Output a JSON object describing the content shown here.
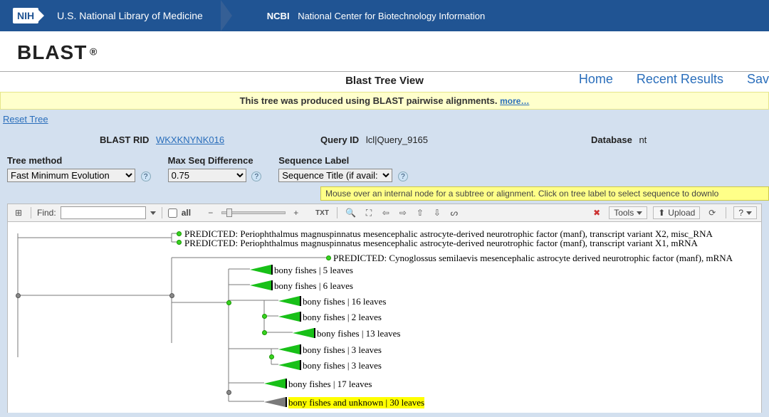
{
  "header": {
    "nih_badge": "NIH",
    "nlm": "U.S. National Library of Medicine",
    "ncbi_short": "NCBI",
    "ncbi_long": "National Center for Biotechnology Information"
  },
  "page": {
    "blast_title": "BLAST",
    "blast_reg": "®",
    "heading": "Blast Tree View",
    "right_links": {
      "home": "Home",
      "recent": "Recent Results",
      "save": "Sav"
    },
    "yellow_bar_text": "This tree was produced using BLAST pairwise alignments.",
    "yellow_bar_more": "more…",
    "reset_link": "Reset Tree"
  },
  "meta": {
    "rid_label": "BLAST RID",
    "rid_value": "WKXKNYNK016",
    "query_label": "Query ID",
    "query_value": "lcl|Query_9165",
    "db_label": "Database",
    "db_value": "nt"
  },
  "controls": {
    "tree_method_label": "Tree method",
    "tree_method_value": "Fast Minimum Evolution",
    "max_seq_label": "Max Seq Difference",
    "max_seq_value": "0.75",
    "seq_label_label": "Sequence Label",
    "seq_label_value": "Sequence Title (if avail:",
    "hint": "Mouse over an internal node for a subtree or alignment. Click on tree label to select sequence to downlo"
  },
  "toolbar": {
    "find_label": "Find:",
    "all": "all",
    "minus": "−",
    "plus": "+",
    "txt": "TXT",
    "tools": "Tools",
    "upload": "Upload",
    "question": "?"
  },
  "tree": {
    "top1": "PREDICTED: Periophthalmus magnuspinnatus mesencephalic astrocyte-derived neurotrophic factor (manf), transcript variant X2, misc_RNA",
    "top2": "PREDICTED: Periophthalmus magnuspinnatus mesencephalic astrocyte-derived neurotrophic factor (manf), transcript variant X1, mRNA",
    "top3": "PREDICTED: Cynoglossus semilaevis mesencephalic astrocyte derived neurotrophic factor (manf), mRNA",
    "collapsed": [
      {
        "label": "bony fishes | 5 leaves",
        "color": "green"
      },
      {
        "label": "bony fishes | 6 leaves",
        "color": "green"
      },
      {
        "label": "bony fishes | 16 leaves",
        "color": "green"
      },
      {
        "label": "bony fishes | 2 leaves",
        "color": "green"
      },
      {
        "label": "bony fishes | 13 leaves",
        "color": "green"
      },
      {
        "label": "bony fishes | 3 leaves",
        "color": "green"
      },
      {
        "label": "bony fishes | 3 leaves",
        "color": "green"
      },
      {
        "label": "bony fishes | 17 leaves",
        "color": "green"
      },
      {
        "label": "bony fishes and unknown | 30 leaves",
        "color": "grey",
        "highlight": true
      }
    ]
  }
}
